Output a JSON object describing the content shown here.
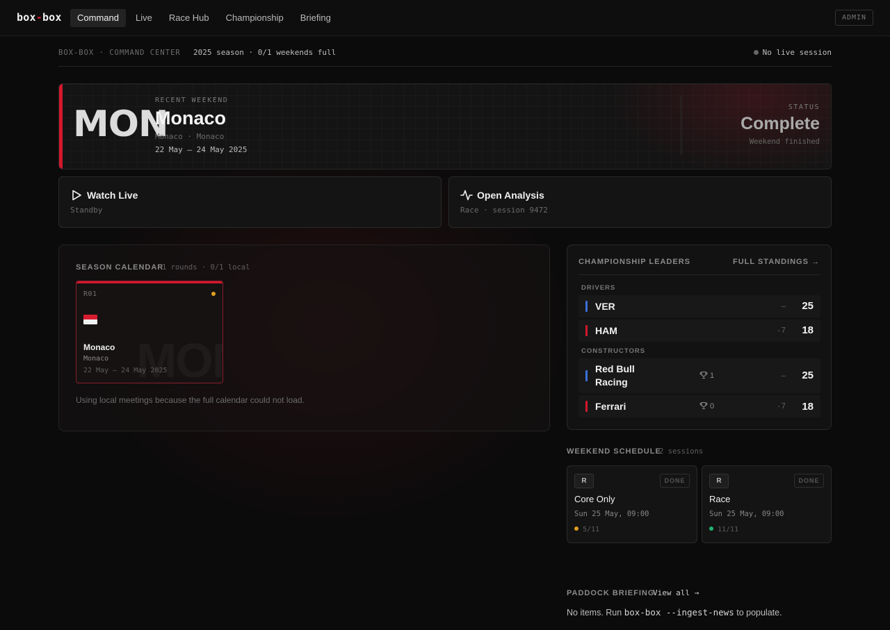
{
  "nav": {
    "brand_left": "box",
    "brand_dash": "-",
    "brand_right": "box",
    "items": [
      {
        "label": "Command",
        "active": true
      },
      {
        "label": "Live",
        "active": false
      },
      {
        "label": "Race Hub",
        "active": false
      },
      {
        "label": "Championship",
        "active": false
      },
      {
        "label": "Briefing",
        "active": false
      }
    ],
    "admin_label": "ADMIN"
  },
  "subbar": {
    "left": "BOX-BOX · COMMAND CENTER",
    "season": "2025 season · 0/1 weekends full",
    "live": "No live session"
  },
  "hero": {
    "code": "MON",
    "label": "RECENT WEEKEND",
    "name": "Monaco",
    "location": "Monaco · Monaco",
    "dates": "22 May – 24 May 2025",
    "status_label": "STATUS",
    "status": "Complete",
    "status_sub": "Weekend finished"
  },
  "actions": {
    "watch": {
      "title": "Watch Live",
      "sub": "Standby"
    },
    "analysis": {
      "title": "Open Analysis",
      "sub": "Race · session 9472"
    }
  },
  "calendar": {
    "title": "SEASON CALENDAR",
    "sub": "1 rounds · 0/1 local",
    "round": {
      "num": "R01",
      "watermark": "MON",
      "name": "Monaco",
      "location": "Monaco",
      "dates": "22 May – 24 May 2025"
    },
    "note": "Using local meetings because the full calendar could not load."
  },
  "standings": {
    "title": "CHAMPIONSHIP LEADERS",
    "link": "FULL STANDINGS →",
    "drivers_label": "DRIVERS",
    "drivers": [
      {
        "name": "VER",
        "gap": "—",
        "points": "25",
        "color": "#3a6fd8"
      },
      {
        "name": "HAM",
        "gap": "-7",
        "points": "18",
        "color": "#d4172c"
      }
    ],
    "constructors_label": "CONSTRUCTORS",
    "constructors": [
      {
        "name_line1": "Red Bull",
        "name_line2": "Racing",
        "wins": "1",
        "gap": "—",
        "points": "25",
        "color": "#3a6fd8"
      },
      {
        "name_line1": "Ferrari",
        "name_line2": "",
        "wins": "0",
        "gap": "-7",
        "points": "18",
        "color": "#d4172c"
      }
    ]
  },
  "schedule": {
    "title": "WEEKEND SCHEDULE",
    "sub": "2 sessions",
    "sessions": [
      {
        "badge": "R",
        "state": "DONE",
        "name": "Core Only",
        "date": "Sun 25 May, 09:00",
        "count": "5/11",
        "dot_color": "#e0a020"
      },
      {
        "badge": "R",
        "state": "DONE",
        "name": "Race",
        "date": "Sun 25 May, 09:00",
        "count": "11/11",
        "dot_color": "#22b573"
      }
    ]
  },
  "briefing": {
    "title": "PADDOCK BRIEFING",
    "link": "View all →",
    "empty_pre": "No items. Run",
    "empty_cmd": "box-box --ingest-news",
    "empty_post": "to populate."
  }
}
